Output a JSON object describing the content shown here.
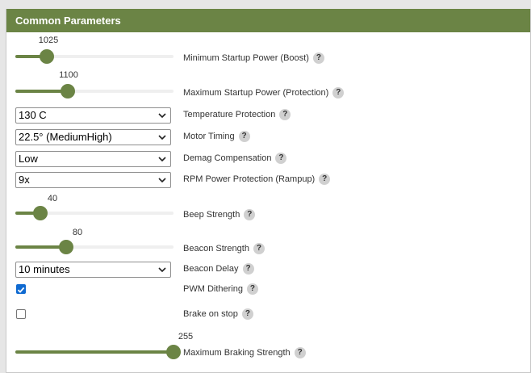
{
  "panel": {
    "title": "Common Parameters"
  },
  "params": {
    "min_startup": {
      "value": "1025",
      "fraction": 0.2,
      "label": "Minimum Startup Power (Boost)"
    },
    "max_startup": {
      "value": "1100",
      "fraction": 0.33,
      "label": "Maximum Startup Power (Protection)"
    },
    "temp_protection": {
      "selected": "130 C",
      "label": "Temperature Protection"
    },
    "motor_timing": {
      "selected": "22.5° (MediumHigh)",
      "label": "Motor Timing"
    },
    "demag": {
      "selected": "Low",
      "label": "Demag Compensation"
    },
    "rpm_power": {
      "selected": "9x",
      "label": "RPM Power Protection (Rampup)"
    },
    "beep_strength": {
      "value": "40",
      "fraction": 0.16,
      "label": "Beep Strength"
    },
    "beacon_strength": {
      "value": "80",
      "fraction": 0.32,
      "label": "Beacon Strength"
    },
    "beacon_delay": {
      "selected": "10 minutes",
      "label": "Beacon Delay"
    },
    "pwm_dithering": {
      "checked": true,
      "label": "PWM Dithering"
    },
    "brake_on_stop": {
      "checked": false,
      "label": "Brake on stop"
    },
    "max_braking": {
      "value": "255",
      "fraction": 1.0,
      "label": "Maximum Braking Strength"
    }
  },
  "help_glyph": "?",
  "colors": {
    "accent": "#6b8445",
    "checkbox": "#0f6ad1"
  }
}
